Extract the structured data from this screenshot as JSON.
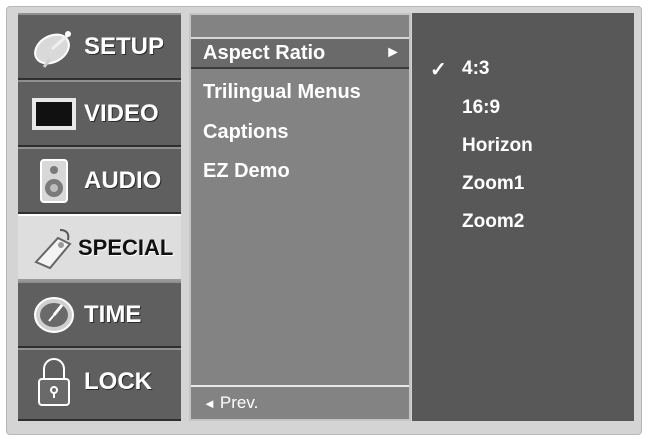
{
  "main_menu": {
    "items": [
      {
        "label": "SETUP",
        "icon": "satellite-dish-icon"
      },
      {
        "label": "VIDEO",
        "icon": "monitor-icon"
      },
      {
        "label": "AUDIO",
        "icon": "speaker-icon"
      },
      {
        "label": "SPECIAL",
        "icon": "tag-icon"
      },
      {
        "label": "TIME",
        "icon": "clock-icon"
      },
      {
        "label": "LOCK",
        "icon": "padlock-icon"
      }
    ],
    "active": "SPECIAL"
  },
  "sub_menu": {
    "items": [
      {
        "label": "Aspect Ratio"
      },
      {
        "label": "Trilingual Menus"
      },
      {
        "label": "Captions"
      },
      {
        "label": "EZ Demo"
      }
    ],
    "selected_arrow": "►",
    "prev_label": "Prev.",
    "prev_glyph": "◄"
  },
  "options": {
    "items": [
      "4:3",
      "16:9",
      "Horizon",
      "Zoom1",
      "Zoom2"
    ],
    "checked": "4:3",
    "check_glyph": "✓"
  },
  "colors": {
    "frame": "#d4d4d4",
    "main_menu_bg": "#5f5f5f",
    "active_item_bg": "#dedede",
    "sub_menu_bg": "#838383",
    "options_bg": "#585858"
  }
}
